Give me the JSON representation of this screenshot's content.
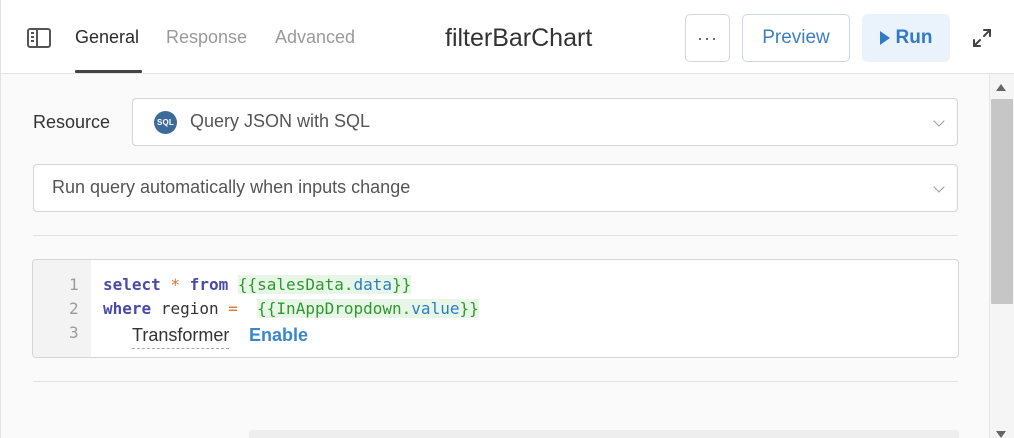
{
  "header": {
    "tabs": [
      {
        "label": "General",
        "active": true
      },
      {
        "label": "Response",
        "active": false
      },
      {
        "label": "Advanced",
        "active": false
      }
    ],
    "query_name": "filterBarChart",
    "more_label": "···",
    "preview_label": "Preview",
    "run_label": "Run",
    "icons": {
      "panel_toggle": "panel-toggle-icon",
      "run": "play-icon",
      "expand": "expand-icon"
    }
  },
  "resource": {
    "label": "Resource",
    "icon_text": "SQL",
    "value": "Query JSON with SQL"
  },
  "trigger": {
    "value": "Run query automatically when inputs change"
  },
  "editor": {
    "line_numbers": [
      "1",
      "2",
      "3"
    ],
    "lines": [
      "select * from {{salesData.data}}",
      "where region =  {{InAppDropdown.value}}",
      ""
    ],
    "line1": {
      "kw1": "select",
      "op": "*",
      "kw2": "from",
      "open": "{{",
      "obj": "salesData",
      "dot": ".",
      "prop": "data",
      "close": "}}"
    },
    "line2": {
      "kw": "where",
      "ident": "region",
      "op": "=",
      "open": "{{",
      "obj": "InAppDropdown",
      "dot": ".",
      "prop": "value",
      "close": "}}"
    }
  },
  "transformer": {
    "label": "Transformer",
    "action": "Enable"
  },
  "colors": {
    "accent": "#3b7fc4",
    "run_bg": "#eaf3fc",
    "keyword": "#4a4aa8",
    "operator": "#e0702a",
    "template": "#2e9a2e",
    "template_bg": "#e8f6e8",
    "property": "#2a7fc0"
  }
}
